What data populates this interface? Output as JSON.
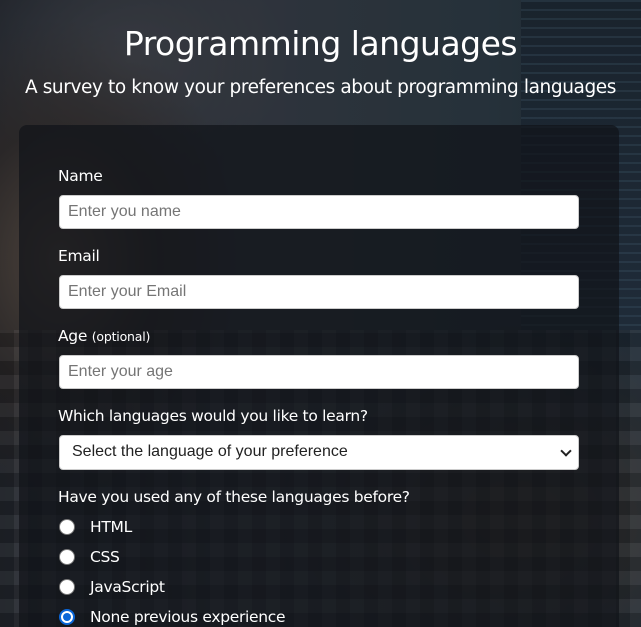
{
  "header": {
    "title": "Programming languages",
    "subtitle": "A survey to know your preferences about programming languages"
  },
  "form": {
    "name": {
      "label": "Name",
      "placeholder": "Enter you name"
    },
    "email": {
      "label": "Email",
      "placeholder": "Enter your Email"
    },
    "age": {
      "label": "Age",
      "optional": "(optional)",
      "placeholder": "Enter your age"
    },
    "languages": {
      "label": "Which languages would you like to learn?",
      "selected": "Select the language of your preference"
    },
    "experience": {
      "label": "Have you used any of these languages before?",
      "options": [
        "HTML",
        "CSS",
        "JavaScript",
        "None previous experience"
      ],
      "checked_index": 3
    }
  },
  "colors": {
    "radio_checked": "#0a66d8"
  }
}
